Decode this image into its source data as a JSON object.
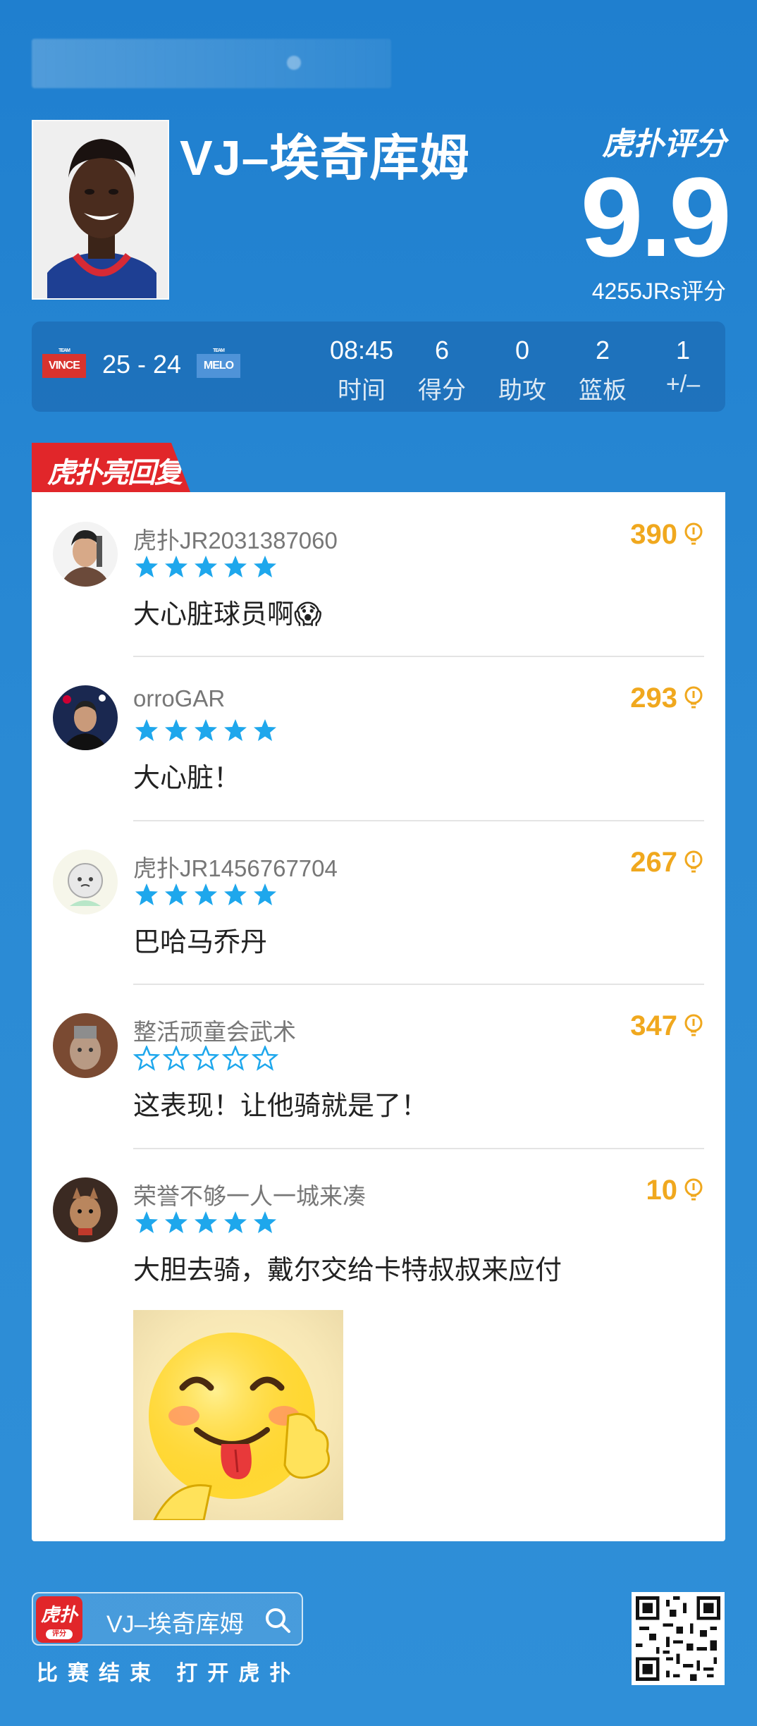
{
  "header": {
    "player_name": "VJ–埃奇库姆",
    "brand_rating_label": "虎扑评分",
    "score": "9.9",
    "rating_count": "4255JRs评分"
  },
  "game": {
    "team_home": {
      "small": "TEAM",
      "name": "VINCE",
      "color": "#d8332e"
    },
    "team_away": {
      "small": "TEAM",
      "name": "MELO",
      "color": "#4f93d8"
    },
    "score": "25 - 24",
    "stats": [
      {
        "value": "08:45",
        "label": "时间"
      },
      {
        "value": "6",
        "label": "得分"
      },
      {
        "value": "0",
        "label": "助攻"
      },
      {
        "value": "2",
        "label": "篮板"
      },
      {
        "value": "1",
        "label": "+/–"
      }
    ]
  },
  "section": {
    "title": "虎扑亮回复"
  },
  "comments": [
    {
      "user": "虎扑JR2031387060",
      "likes": "390",
      "stars": 5,
      "text": "大心脏球员啊😱"
    },
    {
      "user": "orroGAR",
      "likes": "293",
      "stars": 5,
      "text": "大心脏！"
    },
    {
      "user": "虎扑JR1456767704",
      "likes": "267",
      "stars": 5,
      "text": "巴哈马乔丹"
    },
    {
      "user": "整活顽童会武术",
      "likes": "347",
      "stars": 0,
      "text": "这表现！让他骑就是了！"
    },
    {
      "user": "荣誉不够一人一城来凑",
      "likes": "10",
      "stars": 5,
      "text": "大胆去骑，戴尔交给卡特叔叔来应付"
    }
  ],
  "footer": {
    "app_icon_label": "虎扑",
    "app_icon_sub": "评分",
    "search_text": "VJ–埃奇库姆",
    "caption": "比赛结束 打开虎扑"
  },
  "colors": {
    "background": "#2a8ad4",
    "accent_red": "#e1262a",
    "star_blue": "#1ea7ec",
    "likes_gold": "#f0a81e"
  }
}
